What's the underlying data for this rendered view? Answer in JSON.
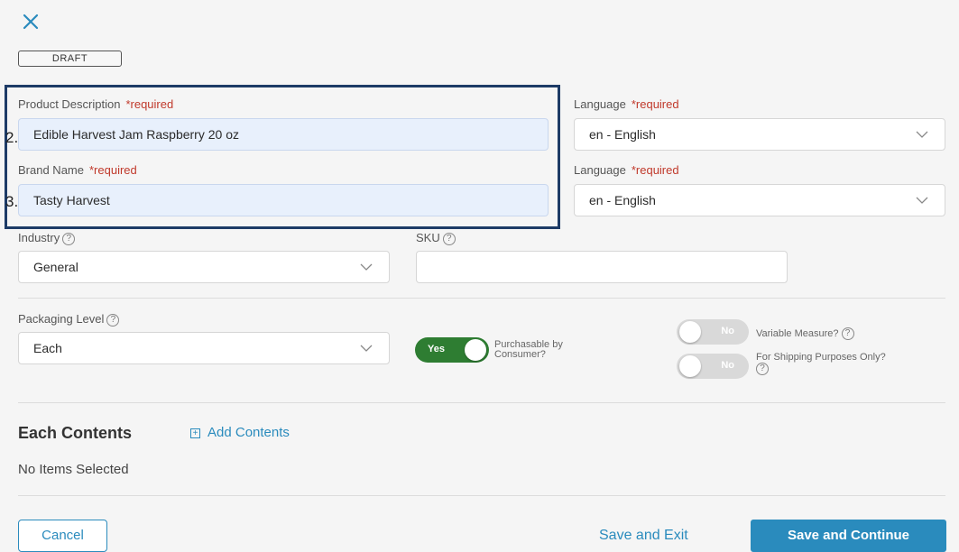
{
  "header": {
    "status_badge": "DRAFT"
  },
  "product_description": {
    "step": "2.",
    "label": "Product Description",
    "required": "*required",
    "value": "Edible Harvest Jam Raspberry 20 oz",
    "language_label": "Language",
    "language_required": "*required",
    "language_value": "en - English"
  },
  "brand_name": {
    "step": "3.",
    "label": "Brand Name",
    "required": "*required",
    "value": "Tasty Harvest",
    "language_label": "Language",
    "language_required": "*required",
    "language_value": "en - English"
  },
  "industry": {
    "label": "Industry",
    "value": "General"
  },
  "sku": {
    "label": "SKU",
    "value": ""
  },
  "packaging_level": {
    "label": "Packaging Level",
    "value": "Each"
  },
  "toggles": {
    "purchasable": {
      "state": "Yes",
      "label_line1": "Purchasable by",
      "label_line2": "Consumer?"
    },
    "variable_measure": {
      "state": "No",
      "label": "Variable Measure?"
    },
    "shipping_only": {
      "state": "No",
      "label": "For Shipping Purposes Only?"
    }
  },
  "contents": {
    "title": "Each Contents",
    "add_label": "Add Contents",
    "add_icon": "+",
    "empty_text": "No Items Selected"
  },
  "help_icon_glyph": "?",
  "footer": {
    "cancel": "Cancel",
    "save_exit": "Save and Exit",
    "save_continue": "Save and Continue"
  },
  "colors": {
    "accent": "#2a8bbd",
    "toggle_on": "#2e7d32",
    "required": "#c0392b",
    "highlight": "#1d3b66"
  }
}
